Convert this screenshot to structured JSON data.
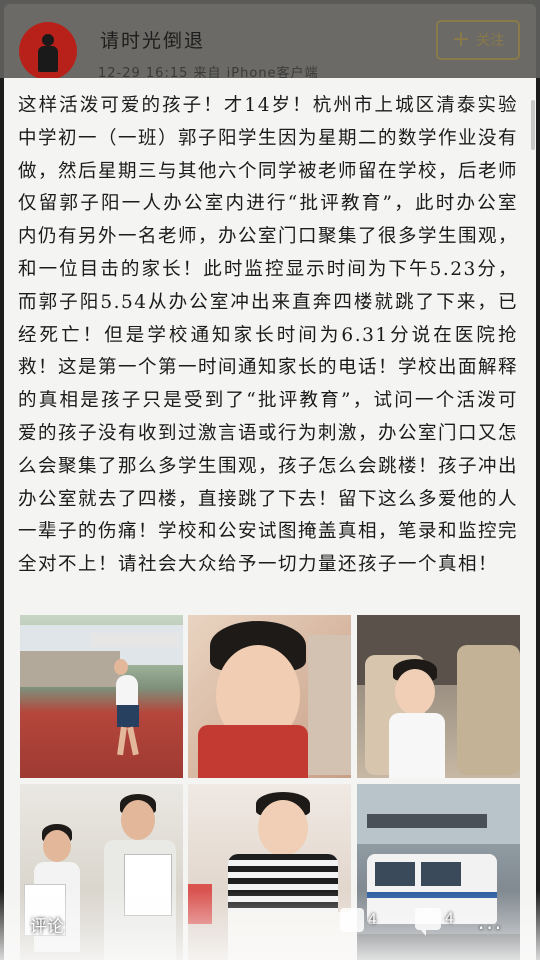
{
  "header": {
    "username": "请时光倒退",
    "meta": "12-29 16:15 来自 iPhone客户端",
    "follow_label": "关注"
  },
  "post": {
    "text": "这样活泼可爱的孩子！才14岁！杭州市上城区清泰实验中学初一（一班）郭子阳学生因为星期二的数学作业没有做，然后星期三与其他六个同学被老师留在学校，后老师仅留郭子阳一人办公室内进行“批评教育”，此时办公室内仍有另外一名老师，办公室门口聚集了很多学生围观，和一位目击的家长！此时监控显示时间为下午5.23分，而郭子阳5.54从办公室冲出来直奔四楼就跳了下来，已经死亡！但是学校通知家长时间为6.31分说在医院抢救！这是第一个第一时间通知家长的电话！学校出面解释的真相是孩子只是受到了“批评教育”，试问一个活泼可爱的孩子没有收到过激言语或行为刺激，办公室门口又怎么会聚集了那么多学生围观，孩子怎么会跳楼！孩子冲出办公室就去了四楼，直接跳了下去！留下这么多爱他的人一辈子的伤痛！学校和公安试图掩盖真相，笔录和监控完全对不上！请社会大众给予一切力量还孩子一个真相！"
  },
  "photos": [
    {
      "name": "running-track"
    },
    {
      "name": "boy-closeup"
    },
    {
      "name": "boy-in-car"
    },
    {
      "name": "boys-with-certificate"
    },
    {
      "name": "boy-striped-shirt"
    },
    {
      "name": "police-van"
    }
  ],
  "actions": {
    "comment_label": "评论",
    "like_count": "4",
    "comment_count": "4",
    "more": "..."
  },
  "colors": {
    "avatar_red": "#b8211a",
    "follow_gold": "#8a7a4a",
    "paper": "#f4f4f2"
  }
}
